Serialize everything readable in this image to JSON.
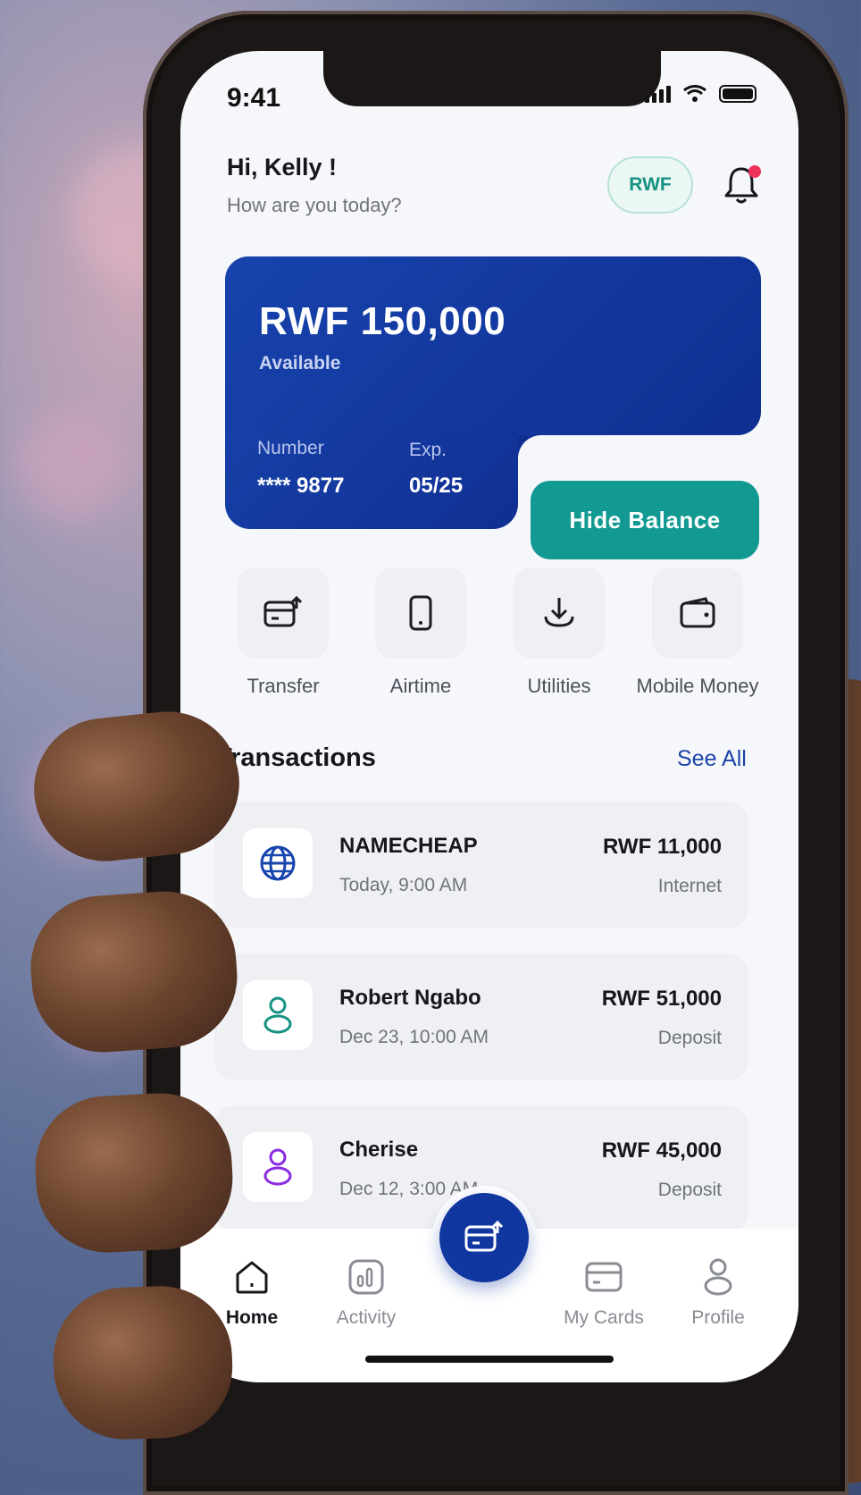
{
  "status_bar": {
    "time": "9:41"
  },
  "header": {
    "greeting": "Hi, Kelly !",
    "subtitle": "How are you today?",
    "currency_label": "RWF"
  },
  "card": {
    "balance": "RWF 150,000",
    "balance_label": "Available",
    "number_label": "Number",
    "number_value": "**** 9877",
    "exp_label": "Exp.",
    "exp_value": "05/25",
    "hide_balance_label": "Hide Balance"
  },
  "quick_actions": [
    {
      "label": "Transfer",
      "icon": "transfer-icon"
    },
    {
      "label": "Airtime",
      "icon": "phone-icon"
    },
    {
      "label": "Utilities",
      "icon": "download-icon"
    },
    {
      "label": "Mobile Money",
      "icon": "wallet-icon"
    }
  ],
  "transactions": {
    "title": "Transactions",
    "see_all_label": "See All",
    "items": [
      {
        "name": "NAMECHEAP",
        "date": "Today, 9:00 AM",
        "amount": "RWF 11,000",
        "category": "Internet",
        "icon": "globe-icon"
      },
      {
        "name": "Robert Ngabo",
        "date": "Dec 23, 10:00 AM",
        "amount": "RWF 51,000",
        "category": "Deposit",
        "icon": "person-icon"
      },
      {
        "name": "Cherise",
        "date": "Dec 12, 3:00 AM",
        "amount": "RWF 45,000",
        "category": "Deposit",
        "icon": "person-icon"
      }
    ]
  },
  "bottom_nav": {
    "items": [
      {
        "label": "Home",
        "icon": "home-icon",
        "active": true
      },
      {
        "label": "Activity",
        "icon": "chart-icon",
        "active": false
      },
      {
        "label": "My Cards",
        "icon": "card-icon",
        "active": false
      },
      {
        "label": "Profile",
        "icon": "person-icon",
        "active": false
      }
    ],
    "fab_icon": "transfer-icon"
  },
  "colors": {
    "card_blue": "#1743ad",
    "teal": "#129a92",
    "link_blue": "#1c44a8",
    "notification_dot": "#f0325a",
    "accent_green": "#169283",
    "accent_purple": "#8a2be2"
  }
}
